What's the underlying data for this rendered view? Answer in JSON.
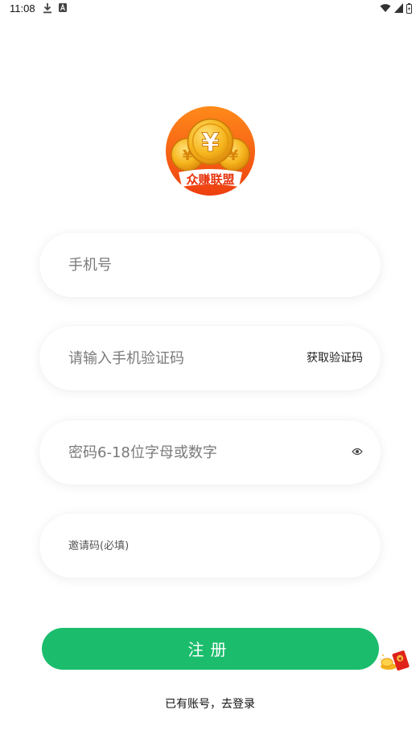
{
  "status_bar": {
    "time": "11:08"
  },
  "logo": {
    "brand_text": "众赚联盟",
    "currency_symbol": "¥"
  },
  "form": {
    "phone_placeholder": "手机号",
    "code_placeholder": "请输入手机验证码",
    "get_code_label": "获取验证码",
    "password_placeholder": "密码6-18位字母或数字",
    "invite_placeholder": "邀请码(必填)"
  },
  "register_button": {
    "label": "注册"
  },
  "login_link": {
    "label": "已有账号，去登录"
  },
  "colors": {
    "primary": "#1bbd6c",
    "logo_orange": "#f0560f",
    "coin_gold": "#f6b51c"
  }
}
